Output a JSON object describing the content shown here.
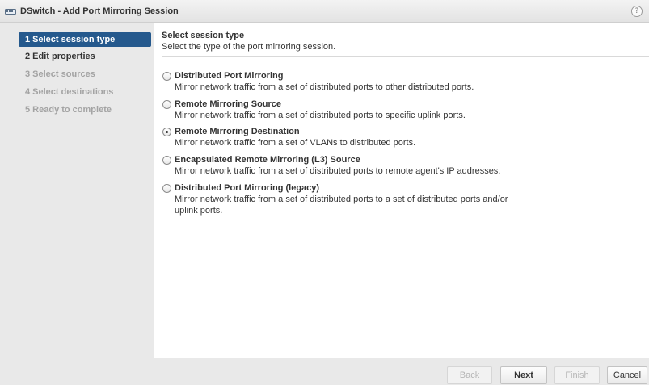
{
  "window": {
    "title": "DSwitch - Add Port Mirroring Session",
    "help_label": "?"
  },
  "steps": [
    {
      "label": "1  Select session type",
      "state": "active"
    },
    {
      "label": "2  Edit properties",
      "state": "enabled"
    },
    {
      "label": "3  Select sources",
      "state": "disabled"
    },
    {
      "label": "4  Select destinations",
      "state": "disabled"
    },
    {
      "label": "5  Ready to complete",
      "state": "disabled"
    }
  ],
  "main": {
    "title": "Select session type",
    "description": "Select the type of the port mirroring session.",
    "options": [
      {
        "label": "Distributed Port Mirroring",
        "description": "Mirror network traffic from a set of distributed ports to other distributed ports.",
        "selected": false
      },
      {
        "label": "Remote Mirroring Source",
        "description": "Mirror network traffic from a set of distributed ports to specific uplink ports.",
        "selected": false
      },
      {
        "label": "Remote Mirroring Destination",
        "description": "Mirror network traffic from a set of VLANs to distributed ports.",
        "selected": true
      },
      {
        "label": "Encapsulated Remote Mirroring (L3) Source",
        "description": "Mirror network traffic from a set of distributed ports to remote agent's IP addresses.",
        "selected": false
      },
      {
        "label": "Distributed Port Mirroring (legacy)",
        "description": "Mirror network traffic from a set of distributed ports to a set of distributed ports and/or uplink ports.",
        "selected": false
      }
    ]
  },
  "footer": {
    "back_label": "Back",
    "next_label": "Next",
    "finish_label": "Finish",
    "cancel_label": "Cancel"
  },
  "colors": {
    "active_step": "#25598d",
    "panel_bg": "#e9e9e9"
  }
}
